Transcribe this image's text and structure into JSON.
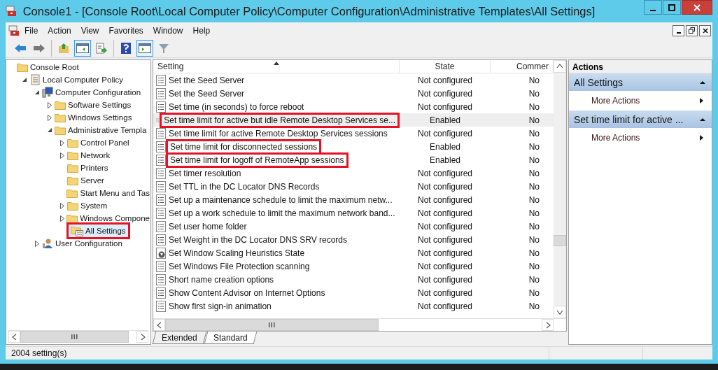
{
  "window": {
    "title": "Console1 - [Console Root\\Local Computer Policy\\Computer Configuration\\Administrative Templates\\All Settings]"
  },
  "menu": [
    "File",
    "Action",
    "View",
    "Favorites",
    "Window",
    "Help"
  ],
  "toolbar": [
    [
      {
        "kind": "back",
        "selected": false
      },
      {
        "kind": "forward",
        "selected": false
      }
    ],
    [
      {
        "kind": "up",
        "selected": false
      },
      {
        "kind": "console-tree",
        "selected": true
      },
      {
        "kind": "export",
        "selected": false
      }
    ],
    [
      {
        "kind": "help",
        "selected": false
      },
      {
        "kind": "action-pane",
        "selected": true
      },
      {
        "kind": "filter",
        "selected": false
      }
    ]
  ],
  "tree": [
    {
      "label": "Console Root",
      "kind": "folder",
      "selected": false,
      "highlighted": false,
      "children": [
        {
          "label": "Local Computer Policy",
          "kind": "policy",
          "expanded": true,
          "selected": false,
          "highlighted": false,
          "children": [
            {
              "label": "Computer Configuration",
              "kind": "computer",
              "expanded": true,
              "selected": false,
              "highlighted": false,
              "children": [
                {
                  "label": "Software Settings",
                  "kind": "folder",
                  "expanded": false,
                  "selected": false,
                  "highlighted": false
                },
                {
                  "label": "Windows Settings",
                  "kind": "folder",
                  "expanded": false,
                  "selected": false,
                  "highlighted": false
                },
                {
                  "label": "Administrative Templa",
                  "kind": "folder",
                  "expanded": true,
                  "selected": false,
                  "highlighted": false,
                  "children": [
                    {
                      "label": "Control Panel",
                      "kind": "folder",
                      "expanded": false,
                      "selected": false,
                      "highlighted": false
                    },
                    {
                      "label": "Network",
                      "kind": "folder",
                      "expanded": false,
                      "selected": false,
                      "highlighted": false
                    },
                    {
                      "label": "Printers",
                      "kind": "folder",
                      "selected": false,
                      "highlighted": false
                    },
                    {
                      "label": "Server",
                      "kind": "folder",
                      "selected": false,
                      "highlighted": false
                    },
                    {
                      "label": "Start Menu and Tas",
                      "kind": "folder",
                      "selected": false,
                      "highlighted": false
                    },
                    {
                      "label": "System",
                      "kind": "folder",
                      "expanded": false,
                      "selected": false,
                      "highlighted": false
                    },
                    {
                      "label": "Windows Compone",
                      "kind": "folder",
                      "expanded": false,
                      "selected": false,
                      "highlighted": false
                    },
                    {
                      "label": "All Settings",
                      "kind": "all-settings",
                      "selected": true,
                      "highlighted": true
                    }
                  ]
                }
              ]
            },
            {
              "label": "User Configuration",
              "kind": "user",
              "expanded": false,
              "selected": false,
              "highlighted": false
            }
          ]
        }
      ]
    }
  ],
  "table": {
    "columns": [
      {
        "label": "Setting",
        "sorted": true
      },
      {
        "label": "State",
        "sorted": false
      },
      {
        "label": "Commer",
        "sorted": false
      }
    ],
    "rows": [
      {
        "setting": "Set the Seed Server",
        "state": "Not configured",
        "comment": "No",
        "kind": "setting",
        "selected": false,
        "highlighted": false
      },
      {
        "setting": "Set the Seed Server",
        "state": "Not configured",
        "comment": "No",
        "kind": "setting",
        "selected": false,
        "highlighted": false
      },
      {
        "setting": "Set time (in seconds) to force reboot",
        "state": "Not configured",
        "comment": "No",
        "kind": "setting",
        "selected": false,
        "highlighted": false
      },
      {
        "setting": "Set time limit for active but idle Remote Desktop Services se...",
        "state": "Enabled",
        "comment": "No",
        "kind": "setting",
        "selected": true,
        "highlighted": true
      },
      {
        "setting": "Set time limit for active Remote Desktop Services sessions",
        "state": "Not configured",
        "comment": "No",
        "kind": "setting",
        "selected": false,
        "highlighted": false
      },
      {
        "setting": "Set time limit for disconnected sessions",
        "state": "Enabled",
        "comment": "No",
        "kind": "setting",
        "selected": false,
        "highlighted": true
      },
      {
        "setting": "Set time limit for logoff of RemoteApp sessions",
        "state": "Enabled",
        "comment": "No",
        "kind": "setting",
        "selected": false,
        "highlighted": true
      },
      {
        "setting": "Set timer resolution",
        "state": "Not configured",
        "comment": "No",
        "kind": "setting",
        "selected": false,
        "highlighted": false
      },
      {
        "setting": "Set TTL  in the DC Locator DNS Records",
        "state": "Not configured",
        "comment": "No",
        "kind": "setting",
        "selected": false,
        "highlighted": false
      },
      {
        "setting": "Set up a maintenance schedule to limit the maximum netw...",
        "state": "Not configured",
        "comment": "No",
        "kind": "setting",
        "selected": false,
        "highlighted": false
      },
      {
        "setting": "Set up a work schedule to limit the maximum network band...",
        "state": "Not configured",
        "comment": "No",
        "kind": "setting",
        "selected": false,
        "highlighted": false
      },
      {
        "setting": "Set user home folder",
        "state": "Not configured",
        "comment": "No",
        "kind": "setting",
        "selected": false,
        "highlighted": false
      },
      {
        "setting": "Set Weight in the DC Locator DNS SRV records",
        "state": "Not configured",
        "comment": "No",
        "kind": "setting",
        "selected": false,
        "highlighted": false
      },
      {
        "setting": "Set Window Scaling Heuristics State",
        "state": "Not configured",
        "comment": "No",
        "kind": "download-setting",
        "selected": false,
        "highlighted": false
      },
      {
        "setting": "Set Windows File Protection scanning",
        "state": "Not configured",
        "comment": "No",
        "kind": "setting",
        "selected": false,
        "highlighted": false
      },
      {
        "setting": "Short name creation options",
        "state": "Not configured",
        "comment": "No",
        "kind": "setting",
        "selected": false,
        "highlighted": false
      },
      {
        "setting": "Show Content Advisor on Internet Options",
        "state": "Not configured",
        "comment": "No",
        "kind": "setting",
        "selected": false,
        "highlighted": false
      },
      {
        "setting": "Show first sign-in animation",
        "state": "Not configured",
        "comment": "No",
        "kind": "setting",
        "selected": false,
        "highlighted": false
      }
    ]
  },
  "tabs": [
    {
      "label": "Extended",
      "selected": false
    },
    {
      "label": "Standard",
      "selected": true
    }
  ],
  "actions": {
    "title": "Actions",
    "sections": [
      {
        "title": "All Settings",
        "expanded": true,
        "items": [
          "More Actions"
        ]
      },
      {
        "title": "Set time limit for active ...",
        "expanded": true,
        "items": [
          "More Actions"
        ]
      }
    ]
  },
  "status_bar": "2004 setting(s)"
}
